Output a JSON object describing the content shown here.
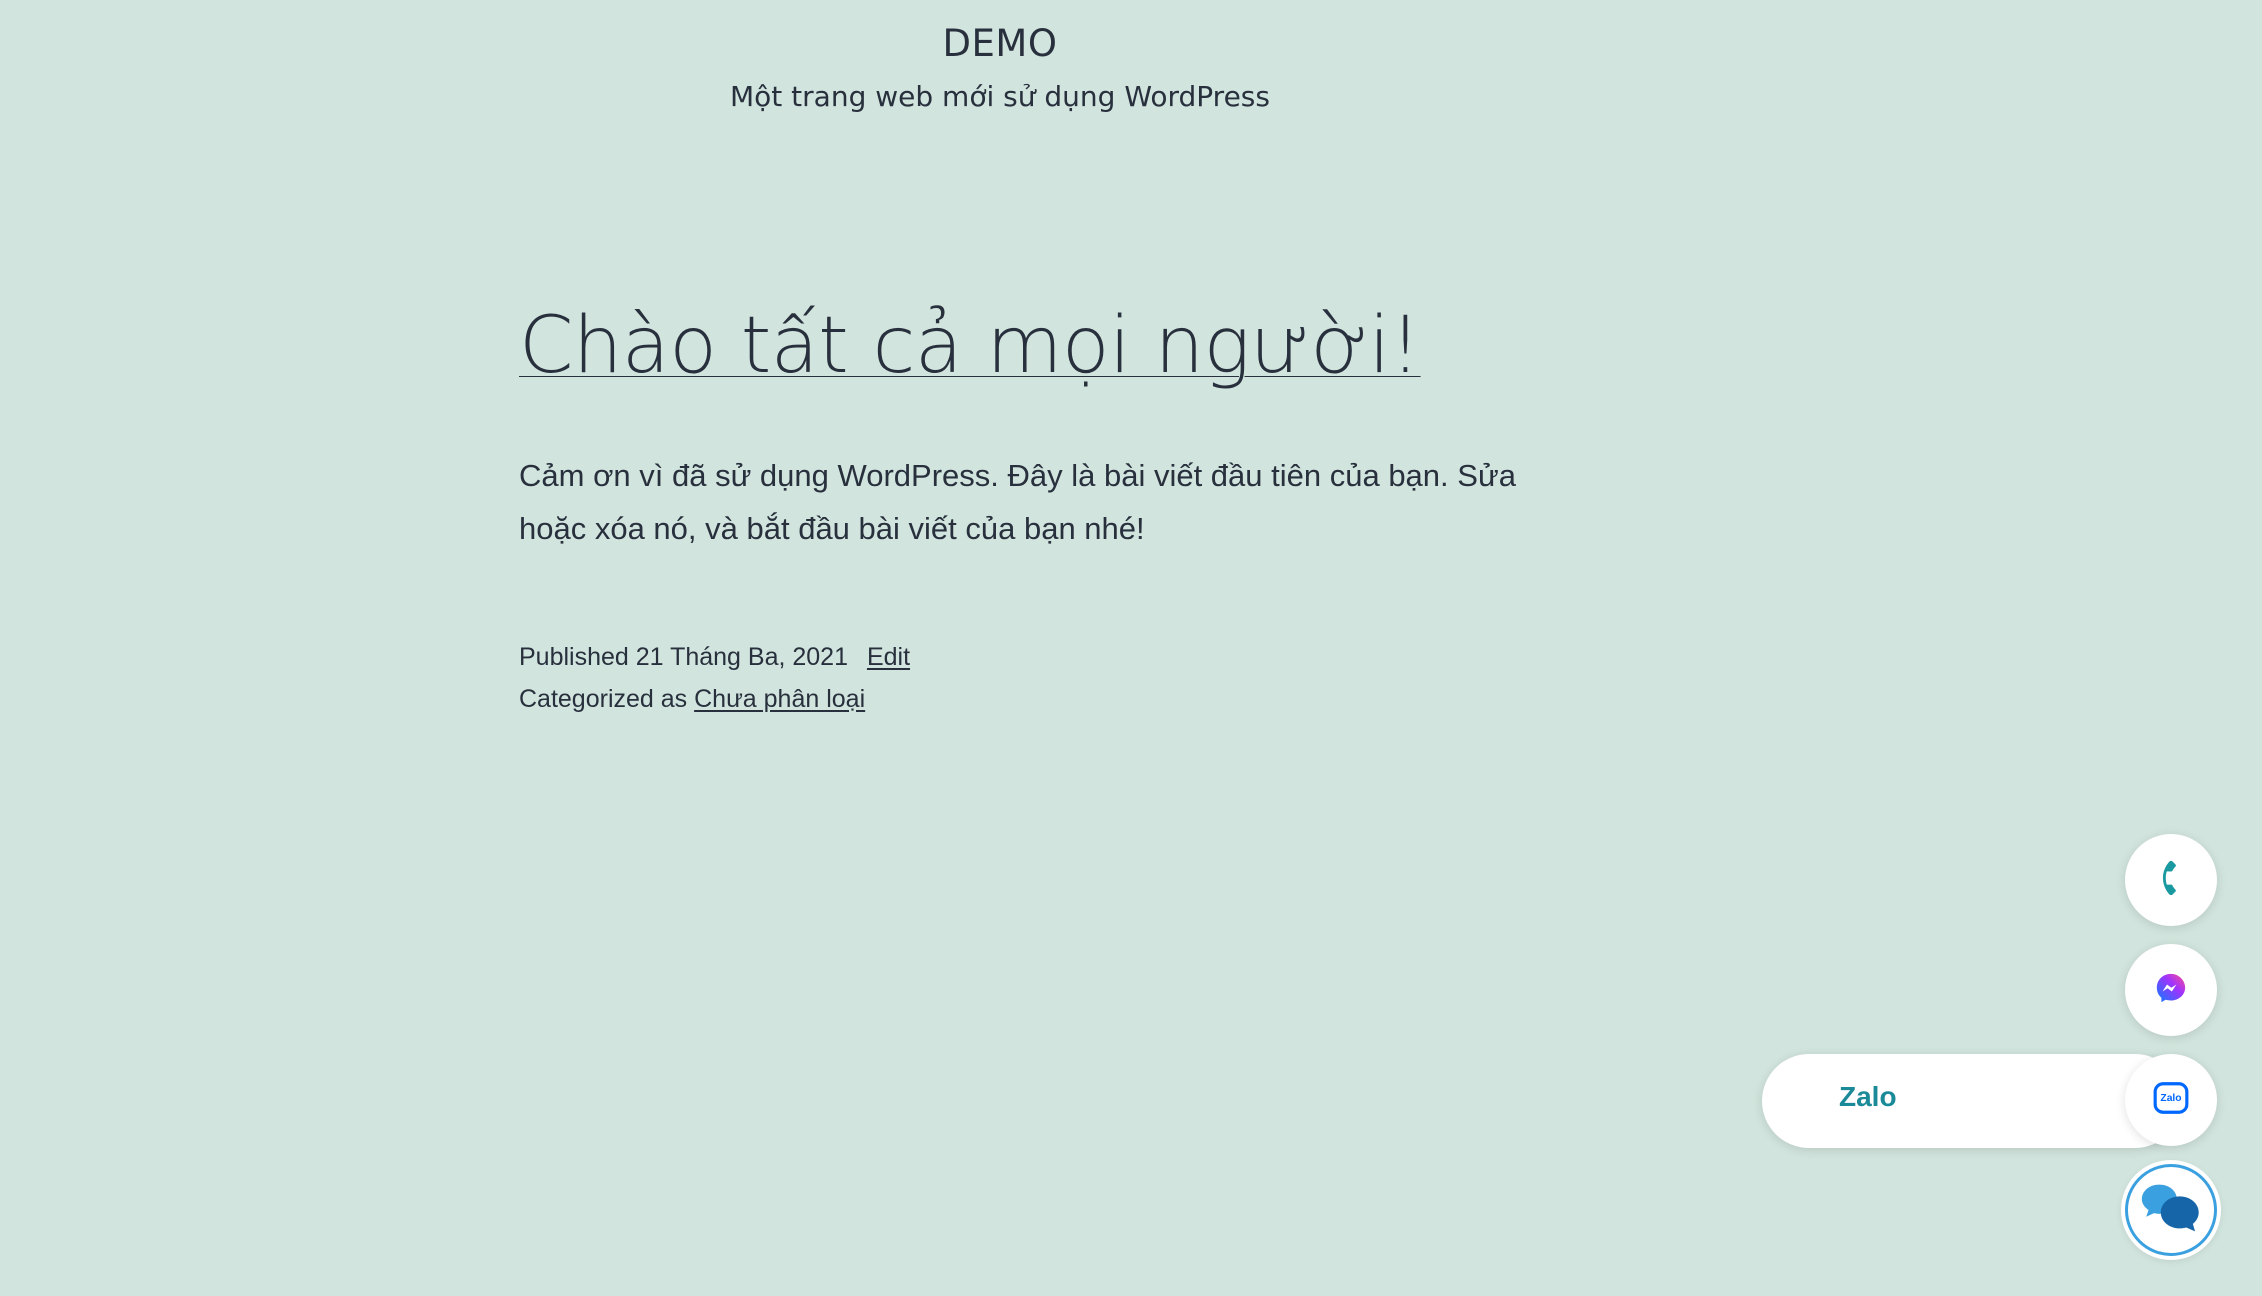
{
  "header": {
    "site_title": "DEMO",
    "site_description": "Một trang web mới sử dụng WordPress"
  },
  "post": {
    "title": "Chào tất cả mọi người!",
    "content": "Cảm ơn vì đã sử dụng WordPress. Đây là bài viết đầu tiên của bạn. Sửa hoặc xóa nó, và bắt đầu bài viết của bạn nhé!",
    "published_label": "Published",
    "published_date": "21 Tháng Ba, 2021",
    "edit_label": "Edit",
    "categorized_label": "Categorized as",
    "category": "Chưa phân loại"
  },
  "contact_widget": {
    "zalo_label": "Zalo",
    "zalo_icon_text": "Zalo",
    "icons": [
      "phone-icon",
      "messenger-icon",
      "zalo-icon",
      "chat-bubbles-icon"
    ],
    "colors": {
      "phone": "#1a9aa0",
      "messenger_start": "#0a7cff",
      "messenger_end": "#ff4d8d",
      "zalo": "#0068ff",
      "zalo_text": "#1a8a99",
      "chat_light": "#3aa0e0",
      "chat_dark": "#1565a8"
    }
  },
  "theme": {
    "background": "#d1e4dd",
    "text": "#28303d"
  }
}
